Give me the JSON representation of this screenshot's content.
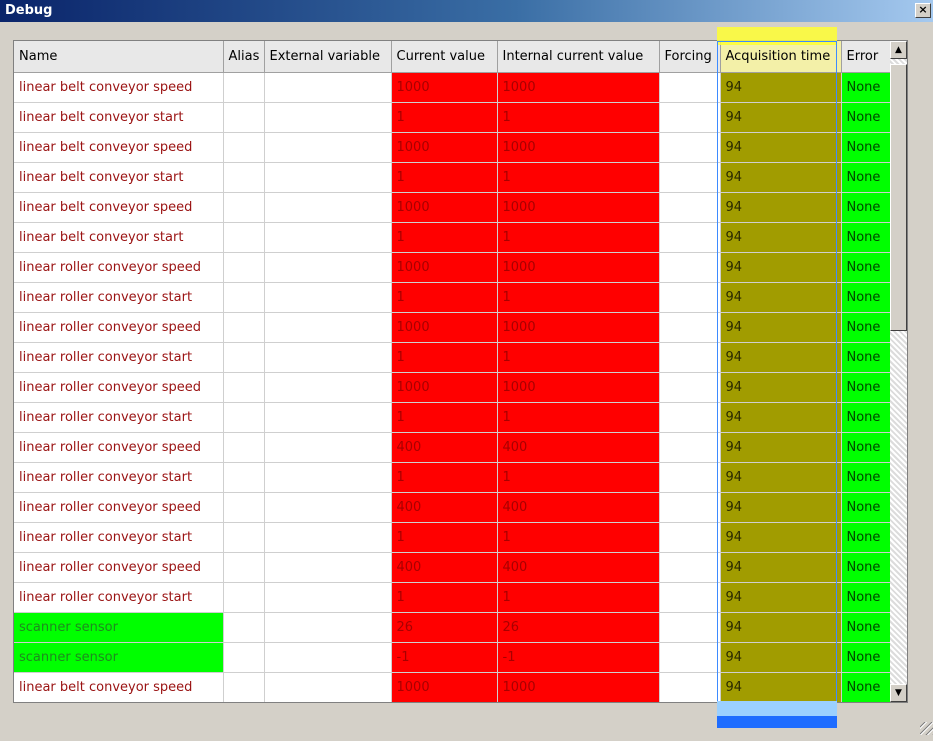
{
  "window": {
    "title": "Debug",
    "close_label": "×"
  },
  "table": {
    "columns": [
      {
        "key": "name",
        "label": "Name"
      },
      {
        "key": "alias",
        "label": "Alias"
      },
      {
        "key": "external",
        "label": "External variable"
      },
      {
        "key": "current",
        "label": "Current value"
      },
      {
        "key": "internal",
        "label": "Internal current value"
      },
      {
        "key": "forcing",
        "label": "Forcing"
      },
      {
        "key": "acq",
        "label": "Acquisition time"
      },
      {
        "key": "error",
        "label": "Error"
      }
    ],
    "rows": [
      {
        "name": "linear belt conveyor speed",
        "current": "1000",
        "internal": "1000",
        "acq": "94",
        "error": "None"
      },
      {
        "name": "linear belt conveyor start",
        "current": "1",
        "internal": "1",
        "acq": "94",
        "error": "None"
      },
      {
        "name": "linear belt conveyor speed",
        "current": "1000",
        "internal": "1000",
        "acq": "94",
        "error": "None"
      },
      {
        "name": "linear belt conveyor start",
        "current": "1",
        "internal": "1",
        "acq": "94",
        "error": "None"
      },
      {
        "name": "linear belt conveyor speed",
        "current": "1000",
        "internal": "1000",
        "acq": "94",
        "error": "None"
      },
      {
        "name": "linear belt conveyor start",
        "current": "1",
        "internal": "1",
        "acq": "94",
        "error": "None"
      },
      {
        "name": "linear roller conveyor speed",
        "current": "1000",
        "internal": "1000",
        "acq": "94",
        "error": "None"
      },
      {
        "name": "linear roller conveyor start",
        "current": "1",
        "internal": "1",
        "acq": "94",
        "error": "None"
      },
      {
        "name": "linear roller conveyor speed",
        "current": "1000",
        "internal": "1000",
        "acq": "94",
        "error": "None"
      },
      {
        "name": "linear roller conveyor start",
        "current": "1",
        "internal": "1",
        "acq": "94",
        "error": "None"
      },
      {
        "name": "linear roller conveyor speed",
        "current": "1000",
        "internal": "1000",
        "acq": "94",
        "error": "None"
      },
      {
        "name": "linear roller conveyor start",
        "current": "1",
        "internal": "1",
        "acq": "94",
        "error": "None"
      },
      {
        "name": "linear roller conveyor speed",
        "current": "400",
        "internal": "400",
        "acq": "94",
        "error": "None"
      },
      {
        "name": "linear roller conveyor start",
        "current": "1",
        "internal": "1",
        "acq": "94",
        "error": "None"
      },
      {
        "name": "linear roller conveyor speed",
        "current": "400",
        "internal": "400",
        "acq": "94",
        "error": "None"
      },
      {
        "name": "linear roller conveyor start",
        "current": "1",
        "internal": "1",
        "acq": "94",
        "error": "None"
      },
      {
        "name": "linear roller conveyor speed",
        "current": "400",
        "internal": "400",
        "acq": "94",
        "error": "None"
      },
      {
        "name": "linear roller conveyor start",
        "current": "1",
        "internal": "1",
        "acq": "94",
        "error": "None"
      },
      {
        "name": "scanner sensor",
        "current": "26",
        "internal": "26",
        "acq": "94",
        "error": "None"
      },
      {
        "name": "scanner sensor",
        "current": "-1",
        "internal": "-1",
        "acq": "94",
        "error": "None"
      },
      {
        "name": "linear belt conveyor speed",
        "current": "1000",
        "internal": "1000",
        "acq": "94",
        "error": "None"
      }
    ]
  },
  "scrollbar": {
    "up_icon": "arrow-up-icon",
    "down_icon": "arrow-down-icon"
  },
  "colors": {
    "value_cell": "#ff0000",
    "acquisition_cell": "#a19c00",
    "error_cell": "#00ff00",
    "name_text": "#9a1212",
    "sensor_name_text": "#1f8a1f",
    "highlight": "#ffff33"
  }
}
